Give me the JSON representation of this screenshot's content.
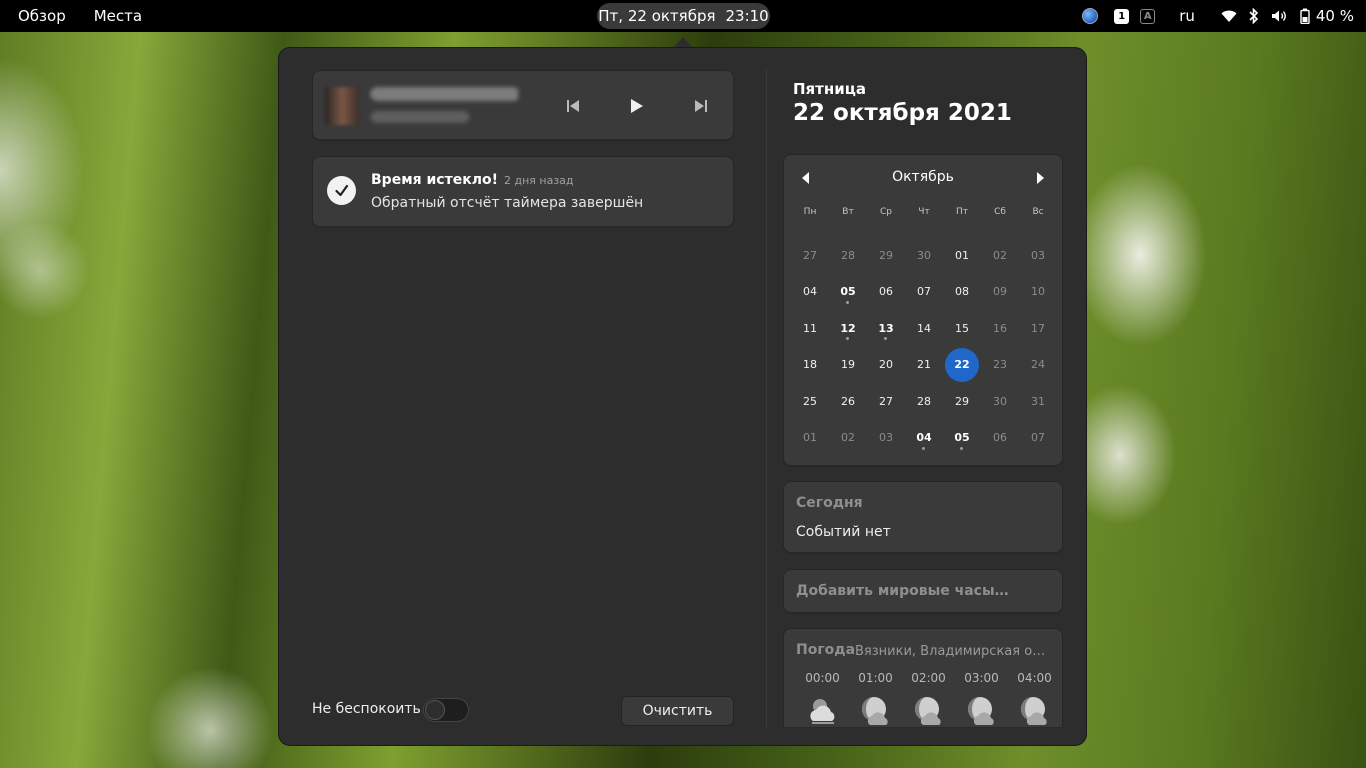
{
  "topbar": {
    "activities": "Обзор",
    "places": "Места",
    "clock_date": "Пт, 22 октября",
    "clock_time": "23:10",
    "workspace_active": "1",
    "workspace_inactive": "A",
    "language": "ru",
    "battery": "40 %",
    "icons": [
      "globe-icon",
      "wifi-icon",
      "bluetooth-icon",
      "volume-icon",
      "battery-icon"
    ]
  },
  "media": {
    "controls": [
      "previous-icon",
      "play-icon",
      "next-icon"
    ]
  },
  "notification": {
    "title": "Время истекло!",
    "time": "2 дня назад",
    "body": "Обратный отсчёт таймера завершён",
    "icon": "check-icon"
  },
  "footer": {
    "dnd_label": "Не беспокоить",
    "dnd_enabled": false,
    "clear_label": "Очистить"
  },
  "date": {
    "weekday": "Пятница",
    "full": "22 октября 2021"
  },
  "calendar": {
    "month": "Октябрь",
    "weekdays": [
      "Пн",
      "Вт",
      "Ср",
      "Чт",
      "Пт",
      "Сб",
      "Вс"
    ],
    "weeks": [
      [
        "27",
        "28",
        "29",
        "30",
        "01",
        "02",
        "03"
      ],
      [
        "04",
        "05",
        "06",
        "07",
        "08",
        "09",
        "10"
      ],
      [
        "11",
        "12",
        "13",
        "14",
        "15",
        "16",
        "17"
      ],
      [
        "18",
        "19",
        "20",
        "21",
        "22",
        "23",
        "24"
      ],
      [
        "25",
        "26",
        "27",
        "28",
        "29",
        "30",
        "31"
      ],
      [
        "01",
        "02",
        "03",
        "04",
        "05",
        "06",
        "07"
      ]
    ],
    "other_month": [
      [
        0,
        0
      ],
      [
        0,
        1
      ],
      [
        0,
        2
      ],
      [
        0,
        3
      ],
      [
        5,
        0
      ],
      [
        5,
        1
      ],
      [
        5,
        2
      ],
      [
        5,
        3
      ],
      [
        5,
        4
      ],
      [
        5,
        5
      ],
      [
        5,
        6
      ]
    ],
    "events": [
      [
        1,
        1
      ],
      [
        2,
        1
      ],
      [
        2,
        2
      ],
      [
        5,
        3
      ],
      [
        5,
        4
      ]
    ],
    "today": [
      3,
      4
    ],
    "accent": "#2166c9"
  },
  "today": {
    "title": "Сегодня",
    "body": "Событий нет"
  },
  "world_clocks": {
    "label": "Добавить мировые часы…"
  },
  "weather": {
    "title": "Погода",
    "location": "Вязники, Владимирская область",
    "forecast": [
      {
        "time": "00:00",
        "icon": "cloudy-night-icon"
      },
      {
        "time": "01:00",
        "icon": "night-clouds-icon"
      },
      {
        "time": "02:00",
        "icon": "night-clouds-icon"
      },
      {
        "time": "03:00",
        "icon": "night-clouds-icon"
      },
      {
        "time": "04:00",
        "icon": "night-clouds-icon"
      }
    ]
  }
}
